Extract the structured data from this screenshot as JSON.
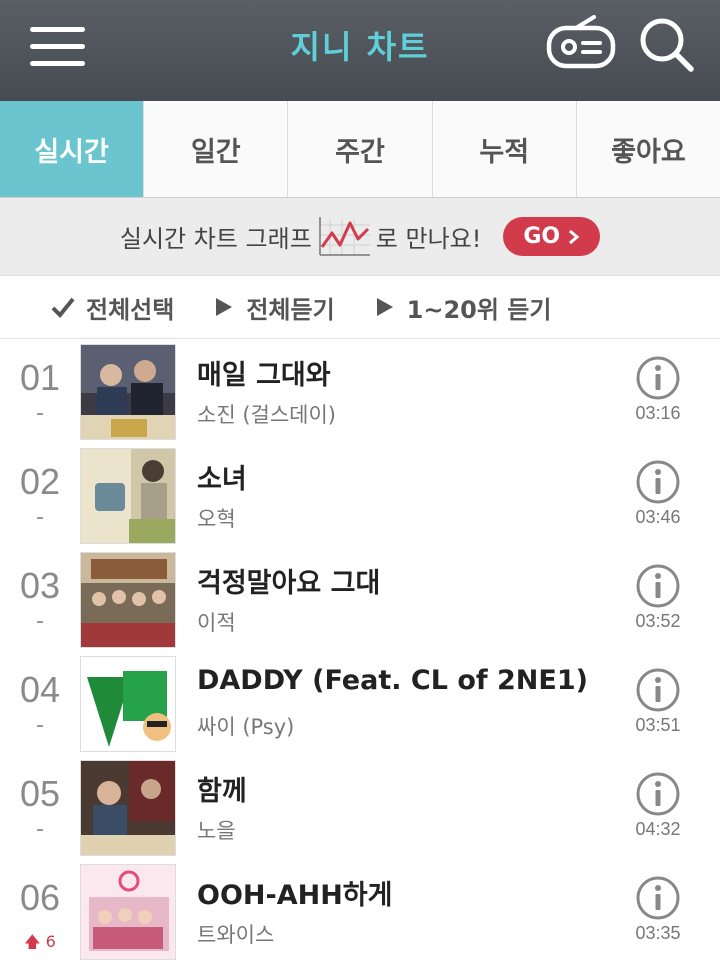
{
  "header": {
    "title": "지니 차트",
    "menu_icon": "hamburger-menu-icon",
    "radio_icon": "radio-icon",
    "search_icon": "search-icon"
  },
  "tabs": [
    {
      "label": "실시간",
      "active": true
    },
    {
      "label": "일간",
      "active": false
    },
    {
      "label": "주간",
      "active": false
    },
    {
      "label": "누적",
      "active": false
    },
    {
      "label": "좋아요",
      "active": false
    }
  ],
  "banner": {
    "text_before": "실시간 차트 그래프",
    "text_after": "로 만나요!",
    "go_label": "GO"
  },
  "controls": {
    "select_all": "전체선택",
    "play_all": "전체듣기",
    "play_top20": "1~20위 듣기"
  },
  "songs": [
    {
      "rank": "01",
      "change": "-",
      "title": "매일 그대와",
      "artist": "소진 (걸스데이)",
      "duration": "03:16"
    },
    {
      "rank": "02",
      "change": "-",
      "title": "소녀",
      "artist": "오혁",
      "duration": "03:46"
    },
    {
      "rank": "03",
      "change": "-",
      "title": "걱정말아요 그대",
      "artist": "이적",
      "duration": "03:52"
    },
    {
      "rank": "04",
      "change": "-",
      "title": "DADDY (Feat. CL of 2NE1)",
      "artist": "싸이 (Psy)",
      "duration": "03:51"
    },
    {
      "rank": "05",
      "change": "-",
      "title": "함께",
      "artist": "노을",
      "duration": "04:32"
    },
    {
      "rank": "06",
      "change": "6",
      "title": "OOH-AHH하게",
      "artist": "트와이스",
      "duration": "03:35"
    }
  ],
  "colors": {
    "header_bg": "#4e535a",
    "accent": "#6ac5cf",
    "title": "#5fd0d8",
    "go_button": "#d23b4c"
  }
}
